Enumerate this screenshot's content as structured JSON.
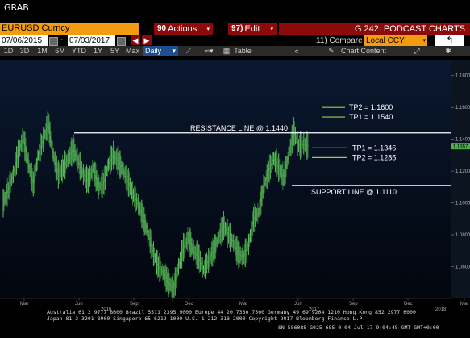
{
  "window": {
    "title": "GRAB"
  },
  "ticker": {
    "value": "EURUSD Curncy"
  },
  "menu": {
    "actions_num": "90",
    "actions_label": "Actions",
    "edit_num": "97)",
    "edit_label": "Edit",
    "page_title": "G 242: PODCAST CHARTS"
  },
  "dates": {
    "start": "07/06/2015",
    "end": "07/03/2017"
  },
  "compare": {
    "prefix": "11)",
    "label": "Compare",
    "currency": "Local CCY"
  },
  "toolbar": {
    "periods": [
      "1D",
      "3D",
      "1M",
      "6M",
      "YTD",
      "1Y",
      "5Y",
      "Max"
    ],
    "frequency": "Daily",
    "table_label": "Table",
    "chart_content_label": "Chart Content"
  },
  "chart_data": {
    "type": "line",
    "ylim": [
      1.04,
      1.19
    ],
    "yticks": [
      "1.1800",
      "1.1600",
      "1.1400",
      "1.1200",
      "1.1000",
      "1.0800",
      "1.0600"
    ],
    "ytick_values": [
      1.18,
      1.16,
      1.14,
      1.12,
      1.1,
      1.08,
      1.06
    ],
    "current_price": "1.1357",
    "current_value": 1.1357,
    "xticks": [
      "Mar",
      "Jun",
      "Sep",
      "Dec",
      "Mar",
      "Jun",
      "Sep",
      "Dec",
      "Mar"
    ],
    "xtick_x": [
      30,
      98,
      166,
      234,
      302,
      370,
      438,
      506,
      576
    ],
    "year_labels": [
      {
        "label": "2016",
        "x": 125
      },
      {
        "label": "2017",
        "x": 383
      },
      {
        "label": "2018",
        "x": 540
      }
    ],
    "series": [
      {
        "values": [
          1.1,
          1.108,
          1.118,
          1.131,
          1.141,
          1.125,
          1.112,
          1.13,
          1.14,
          1.15,
          1.13,
          1.118,
          1.122,
          1.128,
          1.134,
          1.126,
          1.118,
          1.114,
          1.122,
          1.11,
          1.112,
          1.124,
          1.13,
          1.126,
          1.12,
          1.113,
          1.105,
          1.099,
          1.09,
          1.08,
          1.068,
          1.06,
          1.056,
          1.05,
          1.046,
          1.06,
          1.072,
          1.078,
          1.07,
          1.066,
          1.058,
          1.064,
          1.07,
          1.078,
          1.086,
          1.08,
          1.075,
          1.068,
          1.066,
          1.074,
          1.09,
          1.094,
          1.11,
          1.12,
          1.128,
          1.122,
          1.116,
          1.13,
          1.145,
          1.136,
          1.137,
          1.1357
        ]
      }
    ],
    "annotations": {
      "resistance": {
        "label": "RESISTANCE LINE @ 1.1440",
        "value": 1.144
      },
      "support": {
        "label": "SUPPORT LINE @ 1.1110",
        "value": 1.111
      },
      "upper_tp": [
        {
          "label": "TP2 = 1.1600",
          "value": 1.16
        },
        {
          "label": "TP1 = 1.1540",
          "value": 1.154
        }
      ],
      "lower_tp": [
        {
          "label": "TP1 = 1.1346",
          "value": 1.1346
        },
        {
          "label": "TP2 = 1.1285",
          "value": 1.1285
        }
      ]
    }
  },
  "footer": {
    "line1": "Australia 61 2 9777 8600 Brazil 5511 2395 9000 Europe 44 20 7330 7500 Germany 49 69 9204 1210 Hong Kong 852 2977 6000",
    "line2": "Japan 81 3 3201 8900        Singapore 65 6212 1000        U.S. 1 212 318 2000        Copyright 2017 Bloomberg Finance L.P.",
    "line3": "SN 586088 G925-685-0 04-Jul-17  9:04:45 GMT GMT+0:00"
  },
  "colors": {
    "accent_orange": "#f39c12",
    "menu_red": "#8b0a0a",
    "series": "#4caf50",
    "tp_line": "#9bd13a"
  }
}
